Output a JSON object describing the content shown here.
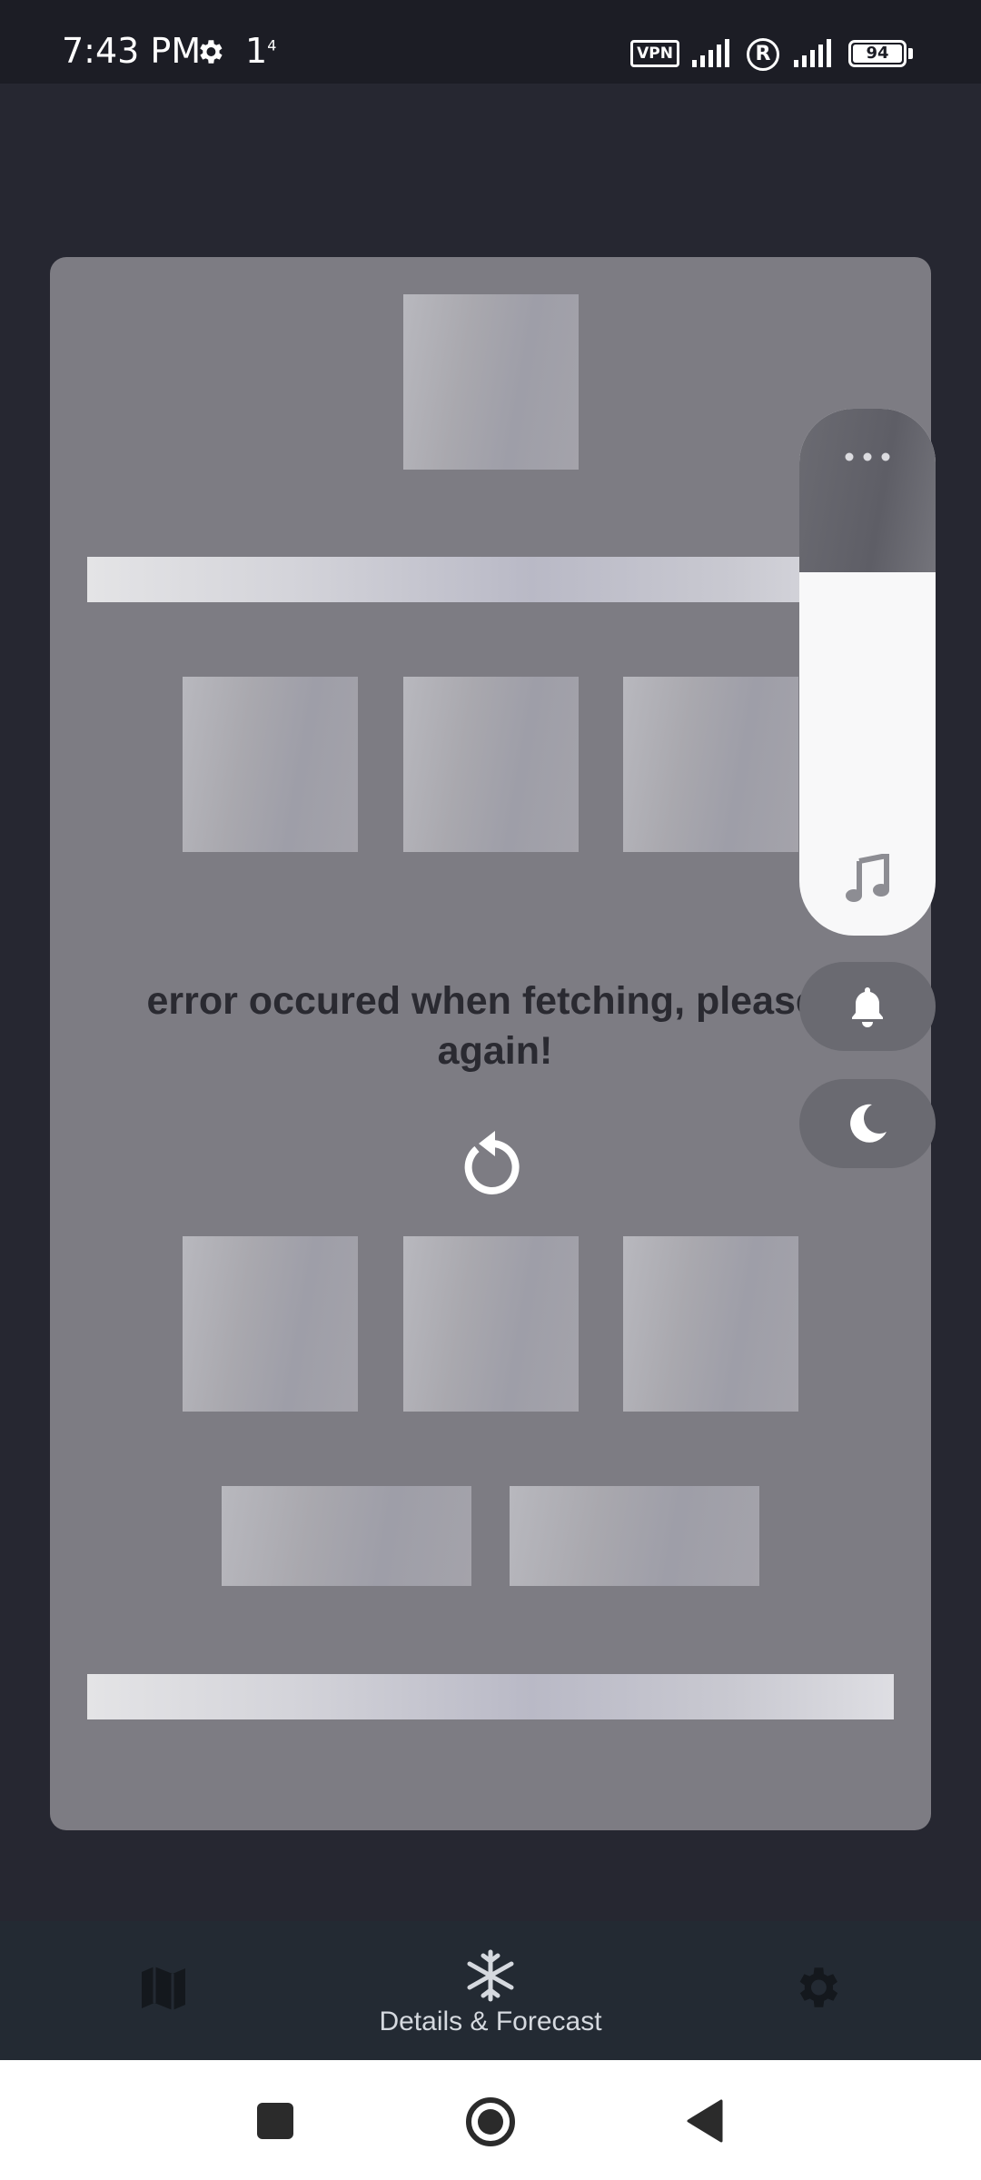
{
  "status_bar": {
    "time": "7:43 PM",
    "extra": "1",
    "extra_sup": "4",
    "vpn": "VPN",
    "roaming": "R",
    "battery": "94",
    "icons": [
      "gear-notification-icon",
      "signal-icon",
      "roaming-icon",
      "battery-icon"
    ]
  },
  "main": {
    "error_message": "error occured when fetching, please r… again!",
    "error_line1": "error occured when fetching, please r",
    "error_line2": "again!",
    "retry_icon": "refresh-icon"
  },
  "floating_panel": {
    "icons": [
      "more-dots-icon",
      "music-note-icon",
      "bell-icon",
      "moon-icon"
    ]
  },
  "bottom_nav": {
    "items": [
      {
        "icon": "map-icon",
        "label": ""
      },
      {
        "icon": "snowflake-icon",
        "label": "Details & Forecast",
        "active": true
      },
      {
        "icon": "gear-icon",
        "label": ""
      }
    ]
  },
  "system_nav": {
    "icons": [
      "recents-square-icon",
      "home-circle-icon",
      "back-triangle-icon"
    ]
  },
  "colors": {
    "background": "#262731",
    "card": "#7d7c83",
    "nav_bar": "#232a33",
    "error_text": "#2a2a31"
  }
}
